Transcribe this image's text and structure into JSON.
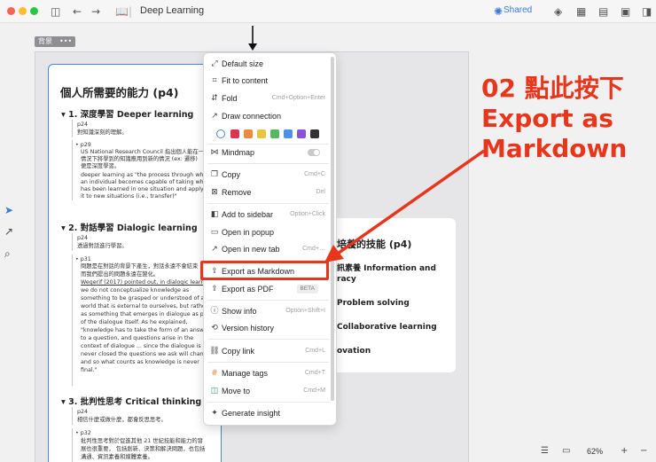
{
  "toolbar": {
    "title": "Deep Learning",
    "shared_label": "Shared",
    "colors": {
      "close": "#ff5f57",
      "minimize": "#febc2e",
      "maximize": "#28c840"
    }
  },
  "canvas": {
    "chip_label": "背景",
    "card1": {
      "title": "個人所需要的能力 (p4)",
      "sections": [
        {
          "heading": "1. 深度學習 Deeper learning",
          "lines": [
            "p24",
            "對知識深刻的理解。",
            "p29",
            "US National Research Council 指出個人能在一",
            "情況下將學到的知識應用到新的情況 (ex: 遷移)",
            "便是深度學習。",
            "deeper learning as \"the process through whi",
            "an individual becomes capable of taking wha",
            "has been learned in one situation and applyi",
            "it to new situations (i.e., transfer)\""
          ]
        },
        {
          "heading": "2. 對話學習 Dialogic learning",
          "lines": [
            "p24",
            "透過對話進行學習。",
            "p31",
            "問題是在對話的背景下產生，對話永遠不會結束",
            "而我們提出的問題永遠在變化。",
            "Wegerif (2017) pointed out, in dialogic learnin",
            "we do not conceptualize knowledge as",
            "something to be grasped or understood of a",
            "world that is external to ourselves, but rather",
            "as something that emerges in dialogue as pa",
            "of the dialogue itself. As he explained,",
            "\"knowledge has to take the form of an answe",
            "to a question, and questions arise in the",
            "context of dialogue ... since the dialogue is",
            "never closed the questions we ask will chang",
            "and so what counts as knowledge is never",
            "final.\""
          ]
        },
        {
          "heading": "3. 批判性思考 Critical thinking",
          "lines": [
            "p24",
            "相信什麼或做什麼，都會反思思考。",
            "p32",
            "批判性思考對於促進其他 21 世紀技能和能力的發",
            "展也很重要，  包括創新、決策和解決問題，也包括",
            "溝通、資訊素養和媒體素養。"
          ]
        }
      ]
    },
    "card2": {
      "title": "培養的技能 (p4)",
      "items": [
        "訊素養 Information and",
        "racy",
        "Problem solving",
        "Collaborative learning",
        "ovation"
      ]
    }
  },
  "context_menu": {
    "items": [
      {
        "icon": "⤢",
        "name": "default-size",
        "label": "Default size",
        "shortcut": ""
      },
      {
        "icon": "⌗",
        "name": "fit-to-content",
        "label": "Fit to content",
        "shortcut": ""
      },
      {
        "icon": "⇵",
        "name": "fold",
        "label": "Fold",
        "shortcut": "Cmd+Option+Enter"
      },
      {
        "icon": "↗",
        "name": "draw-connection",
        "label": "Draw connection",
        "shortcut": ""
      },
      {
        "icon": "⋈",
        "name": "mindmap",
        "label": "Mindmap",
        "shortcut": ""
      },
      {
        "icon": "❐",
        "name": "copy",
        "label": "Copy",
        "shortcut": "Cmd+C"
      },
      {
        "icon": "⊠",
        "name": "remove",
        "label": "Remove",
        "shortcut": "Del"
      },
      {
        "icon": "◧",
        "name": "add-to-sidebar",
        "label": "Add to sidebar",
        "shortcut": "Option+Click"
      },
      {
        "icon": "▭",
        "name": "open-in-popup",
        "label": "Open in popup",
        "shortcut": ""
      },
      {
        "icon": "↗",
        "name": "open-in-new-tab",
        "label": "Open in new tab",
        "shortcut": "Cmd+…"
      },
      {
        "icon": "⇪",
        "name": "export-as-markdown",
        "label": "Export as Markdown",
        "shortcut": ""
      },
      {
        "icon": "⇪",
        "name": "export-as-pdf",
        "label": "Export as PDF",
        "shortcut": ""
      },
      {
        "icon": "ⓘ",
        "name": "show-info",
        "label": "Show info",
        "shortcut": "Option+Shift+I"
      },
      {
        "icon": "⟲",
        "name": "version-history",
        "label": "Version history",
        "shortcut": ""
      },
      {
        "icon": "⛓",
        "name": "copy-link",
        "label": "Copy link",
        "shortcut": "Cmd+L"
      },
      {
        "icon": "#",
        "name": "manage-tags",
        "label": "Manage tags",
        "shortcut": "Cmd+T"
      },
      {
        "icon": "◫",
        "name": "move-to",
        "label": "Move to",
        "shortcut": "Cmd+M"
      },
      {
        "icon": "✦",
        "name": "generate-insight",
        "label": "Generate insight",
        "shortcut": ""
      }
    ],
    "beta_label": "BETA",
    "color_swatches": [
      "#ffffff",
      "#d9374f",
      "#ef8a3c",
      "#e9c440",
      "#57b85e",
      "#4e90e8",
      "#8a52d6",
      "#333333"
    ]
  },
  "annotation": {
    "lines": [
      "02 點此按下",
      "Export as",
      "Markdown"
    ],
    "color": "#e8361c"
  },
  "footer": {
    "zoom": "62%"
  }
}
